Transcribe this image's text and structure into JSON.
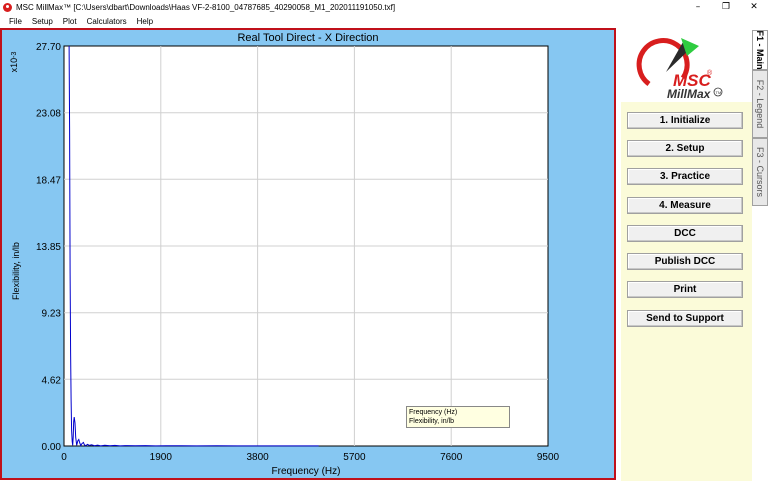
{
  "window": {
    "title": "MSC MillMax™ [C:\\Users\\dbart\\Downloads\\Haas VF-2-8100_04787685_40290058_M1_202011191050.txf]",
    "controls": [
      "–",
      "❐",
      "✕"
    ]
  },
  "menu": [
    "File",
    "Setup",
    "Plot",
    "Calculators",
    "Help"
  ],
  "plot": {
    "title": "Real Tool Direct - X Direction",
    "y_exponent_base": "x10",
    "y_exponent": "-3",
    "legend": [
      "Frequency (Hz)",
      "Flexibility, in/lb"
    ]
  },
  "chart_data": {
    "type": "line",
    "title": "Real Tool Direct - X Direction",
    "xlabel": "Frequency (Hz)",
    "ylabel": "Flexibility, in/lb",
    "xlim": [
      0,
      9500
    ],
    "ylim": [
      0,
      27.7
    ],
    "xticks": [
      "0",
      "1900",
      "3800",
      "5700",
      "7600",
      "9500"
    ],
    "yticks": [
      "0.00",
      "4.62",
      "9.23",
      "13.85",
      "18.47",
      "23.08",
      "27.70"
    ],
    "grid": true,
    "series": [
      {
        "color": "#0000cc",
        "x": [
          100,
          110,
          120,
          130,
          140,
          150,
          160,
          170,
          180,
          190,
          200,
          215,
          230,
          250,
          270,
          290,
          310,
          330,
          350,
          380,
          400,
          430,
          460,
          500,
          540,
          600,
          660,
          720,
          800,
          900,
          1000,
          1100,
          1200,
          1400,
          1600,
          1800,
          2000,
          2300,
          2600,
          3000,
          3400,
          3800,
          4200,
          4600,
          5000
        ],
        "y": [
          27.7,
          22.0,
          12.0,
          6.5,
          3.2,
          1.1,
          0.3,
          0.05,
          0.6,
          1.7,
          2.0,
          1.6,
          0.6,
          0.05,
          0.35,
          0.45,
          0.2,
          0.03,
          0.15,
          0.25,
          0.08,
          0.02,
          0.12,
          0.04,
          0.08,
          0.02,
          0.06,
          0.01,
          0.05,
          0.02,
          0.04,
          0.01,
          0.03,
          0.02,
          0.03,
          0.01,
          0.02,
          0.02,
          0.01,
          0.02,
          0.01,
          0.01,
          0.01,
          0.01,
          0.01
        ]
      }
    ]
  },
  "sidebar": {
    "logo": {
      "brand": "MSC",
      "product": "MillMax",
      "registered": "®",
      "trademark": "TM"
    },
    "buttons": [
      "1. Initialize",
      "2. Setup",
      "3. Practice",
      "4. Measure",
      "DCC",
      "Publish DCC",
      "Print",
      "Send to Support"
    ]
  },
  "tabs": [
    "F1 - Main",
    "F2 - Legend",
    "F3 - Cursors"
  ],
  "colors": {
    "plot_bg": "#86c7f2",
    "panel_border": "#c0101a",
    "sidebar_bg": "#fbfbd9",
    "trace": "#0000cc"
  }
}
